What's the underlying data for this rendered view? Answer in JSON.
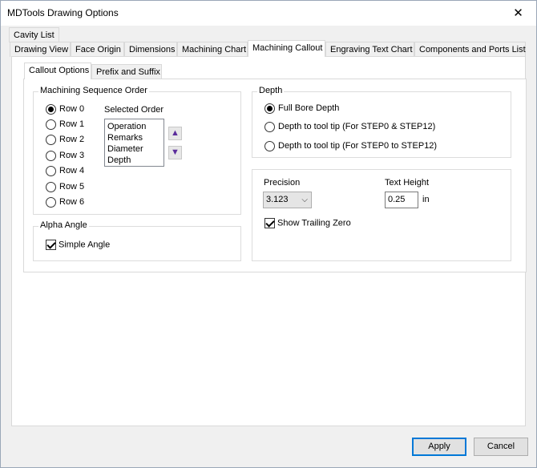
{
  "window": {
    "title": "MDTools Drawing Options",
    "close_glyph": "✕"
  },
  "top_tab": {
    "label": "Cavity List"
  },
  "tabs": [
    {
      "label": "Drawing View"
    },
    {
      "label": "Face Origin"
    },
    {
      "label": "Dimensions"
    },
    {
      "label": "Machining Chart"
    },
    {
      "label": "Machining Callout"
    },
    {
      "label": "Engraving Text Chart"
    },
    {
      "label": "Components and Ports List"
    }
  ],
  "subtabs": [
    {
      "label": "Callout Options"
    },
    {
      "label": "Prefix and Suffix"
    }
  ],
  "sequence": {
    "title": "Machining Sequence Order",
    "rows": [
      {
        "label": "Row 0",
        "selected": true
      },
      {
        "label": "Row 1",
        "selected": false
      },
      {
        "label": "Row 2",
        "selected": false
      },
      {
        "label": "Row 3",
        "selected": false
      },
      {
        "label": "Row 4",
        "selected": false
      },
      {
        "label": "Row 5",
        "selected": false
      },
      {
        "label": "Row 6",
        "selected": false
      }
    ],
    "selected_order_label": "Selected Order",
    "selected_order_items": [
      "Operation",
      "Remarks",
      "Diameter",
      "Depth"
    ],
    "up_icon": "▲",
    "down_icon": "▼"
  },
  "alpha": {
    "title": "Alpha Angle",
    "simple_angle_label": "Simple Angle",
    "simple_angle_checked": true
  },
  "depth": {
    "title": "Depth",
    "options": [
      {
        "label": "Full Bore Depth",
        "selected": true
      },
      {
        "label": "Depth to tool tip (For STEP0 & STEP12)",
        "selected": false
      },
      {
        "label": "Depth to tool tip (For STEP0 to STEP12)",
        "selected": false
      }
    ]
  },
  "precision": {
    "label": "Precision",
    "value": "3.123",
    "chevron": "⌵"
  },
  "text_height": {
    "label": "Text Height",
    "value": "0.25",
    "unit": "in"
  },
  "trailing_zero": {
    "label": "Show Trailing Zero",
    "checked": true
  },
  "buttons": {
    "apply": "Apply",
    "cancel": "Cancel"
  },
  "colors": {
    "accent": "#0078d7",
    "arrow": "#5b2d9c"
  }
}
